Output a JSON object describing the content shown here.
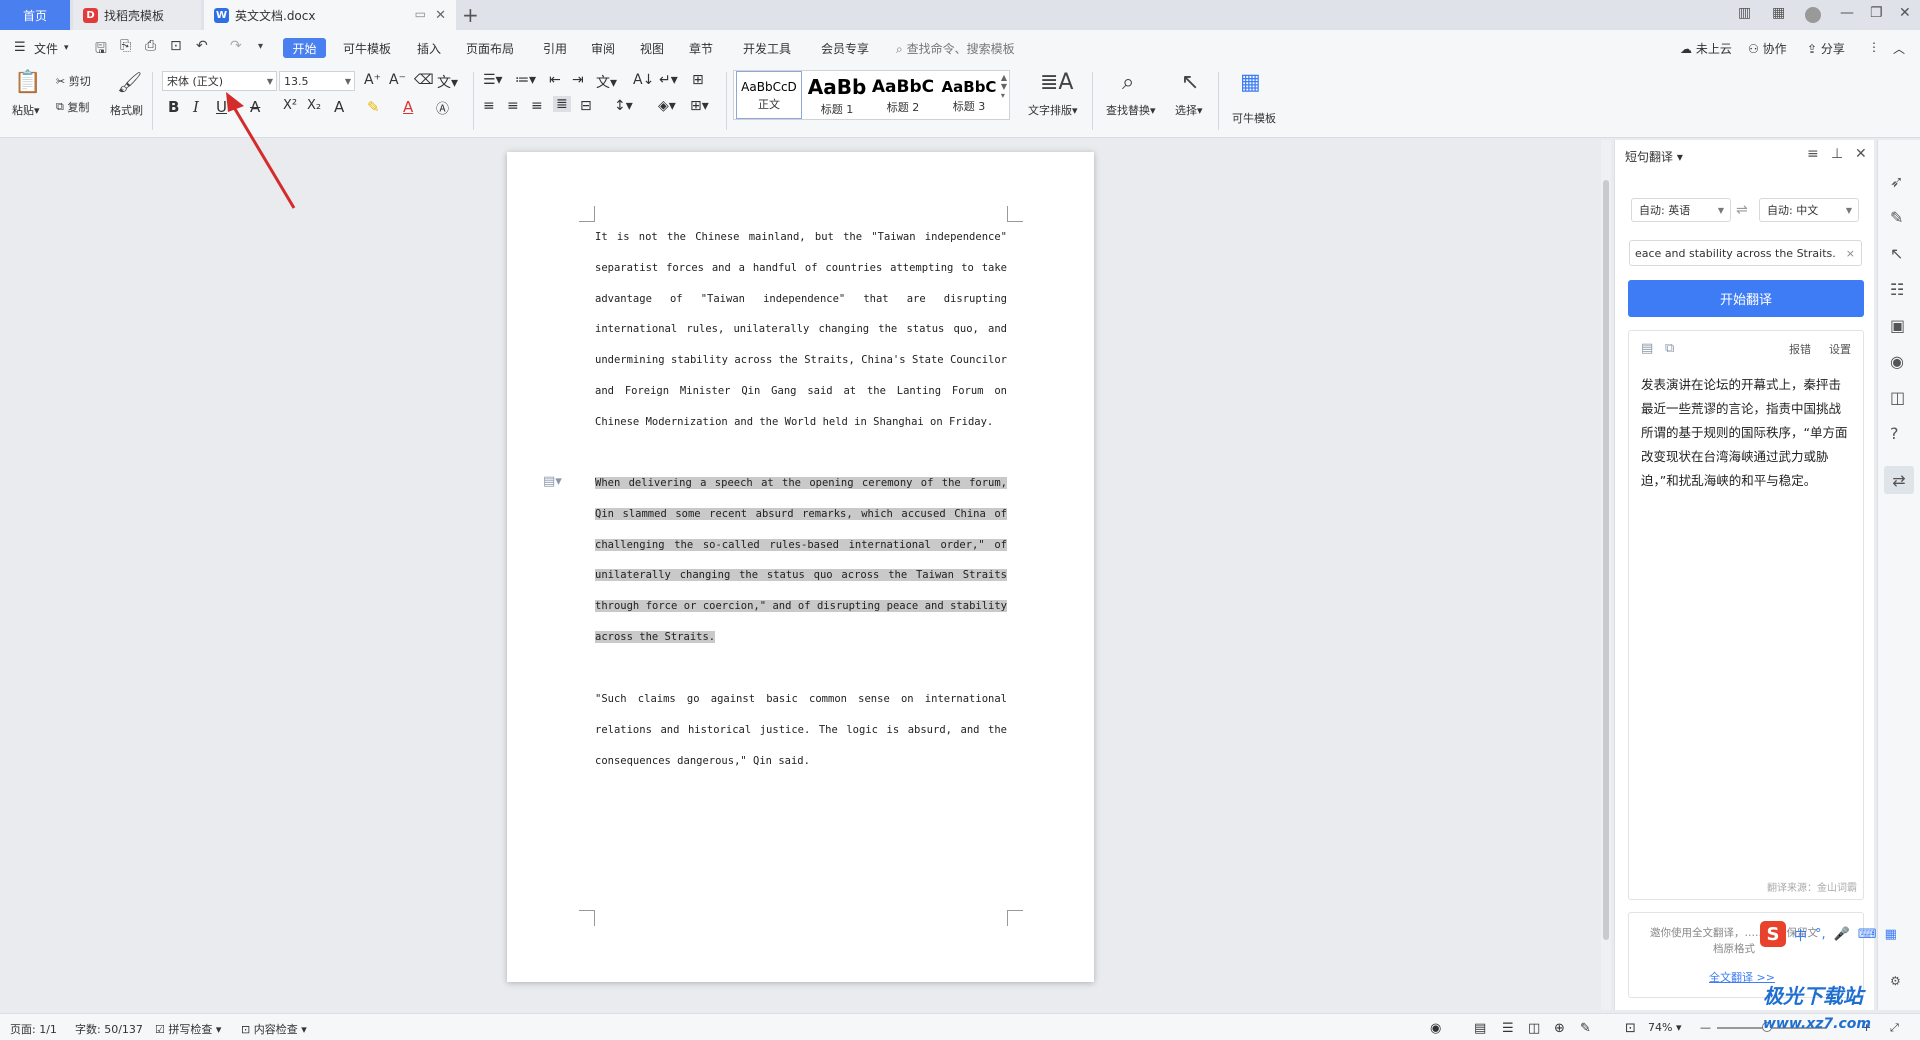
{
  "tabs": {
    "home": "首页",
    "template": "找稻壳模板",
    "doc": "英文文档.docx",
    "add": "+"
  },
  "menubar": {
    "file": "文件",
    "items": [
      "开始",
      "可牛模板",
      "插入",
      "页面布局",
      "引用",
      "审阅",
      "视图",
      "章节",
      "开发工具",
      "会员专享"
    ],
    "search_placeholder": "查找命令、搜索模板",
    "right": {
      "cloud": "未上云",
      "collab": "协作",
      "share": "分享"
    }
  },
  "ribbon": {
    "paste": "粘贴",
    "cut": "剪切",
    "copy": "复制",
    "format_painter": "格式刷",
    "font_name": "宋体 (正文)",
    "font_size": "13.5",
    "styles": [
      {
        "sample": "AaBbCcD",
        "name": "正文"
      },
      {
        "sample": "AaBb",
        "name": "标题 1"
      },
      {
        "sample": "AaBbC",
        "name": "标题 2"
      },
      {
        "sample": "AaBbC",
        "name": "标题 3"
      }
    ],
    "text_layout": "文字排版",
    "find_replace": "查找替换",
    "select": "选择",
    "keniu_template": "可牛模板"
  },
  "document": {
    "paragraphs": [
      "It is not the Chinese mainland, but the \"Taiwan independence\" separatist forces and a handful of countries attempting to take advantage of \"Taiwan independence\" that are disrupting international rules, unilaterally changing the status quo, and undermining stability across the Straits, China's State Councilor and Foreign Minister Qin Gang said at the Lanting Forum on Chinese Modernization and the World held in Shanghai on Friday.",
      "When delivering a speech at the opening ceremony of the forum, Qin slammed some recent absurd remarks, which accused China of challenging the so-called rules-based international order,\" of unilaterally changing the status quo across the Taiwan Straits through force or coercion,\" and of disrupting peace and stability across the Straits.",
      "\"Such claims go against basic common sense on international relations and historical justice. The logic is absurd, and the consequences dangerous,\" Qin said."
    ]
  },
  "pane": {
    "title": "短句翻译",
    "from_lang": "自动: 英语",
    "to_lang": "自动: 中文",
    "source_text": "eace and stability across the Straits.",
    "translate_btn": "开始翻译",
    "report": "报错",
    "settings": "设置",
    "result": "发表演讲在论坛的开幕式上，秦抨击最近一些荒谬的言论，指责中国挑战所谓的基于规则的国际秩序，“单方面改变现状在台湾海峡通过武力或胁迫，”和扰乱海峡的和平与稳定。",
    "source_note": "翻译来源：金山词霸",
    "invite": "邀你使用全文翻译，……言，保留文档原格式",
    "full_translate": "全文翻译 >>"
  },
  "status": {
    "page": "页面: 1/1",
    "words": "字数: 50/137",
    "spell": "拼写检查",
    "content": "内容检查",
    "zoom": "74%"
  },
  "ime": {
    "logo": "S",
    "mode": "中"
  },
  "watermark": {
    "main": "极光下载站",
    "sub": "www.xz7.com"
  }
}
